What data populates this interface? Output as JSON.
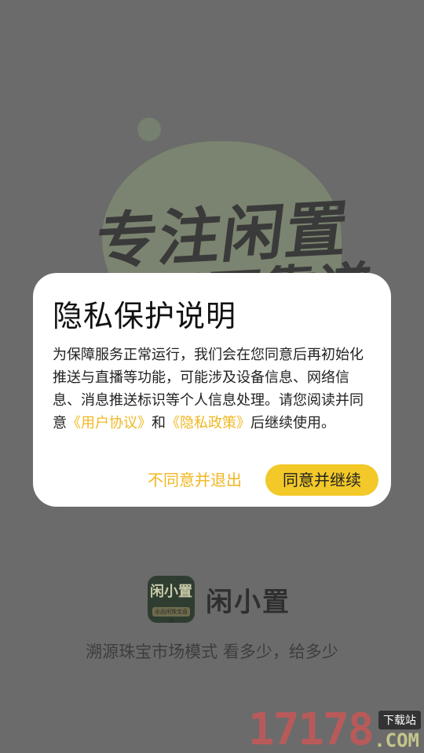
{
  "splash": {
    "slogan_line1": "专注闲置",
    "slogan_line2": "不只不靠谱",
    "brand_logo_text": "闲小置",
    "brand_logo_subtext": "全品闲珠宝直销",
    "brand_name": "闲小置",
    "brand_tagline": "溯源珠宝市场模式  看多少，给多少"
  },
  "watermark": {
    "number": "17178",
    "tag": "下载站",
    "domain": ".COM"
  },
  "dialog": {
    "title": "隐私保护说明",
    "body_prefix": "为保障服务正常运行，我们会在您同意后再初始化推送与直播等功能，可能涉及设备信息、网络信息、消息推送标识等个人信息处理。请您阅读并同意",
    "link_user_agreement": "《用户协议》",
    "body_and": "和",
    "link_privacy_policy": "《隐私政策》",
    "body_suffix": "后继续使用。",
    "disagree_label": "不同意并退出",
    "agree_label": "同意并继续"
  },
  "colors": {
    "accent": "#f2c928",
    "link": "#f0b720",
    "overlay": "#6b6b6b"
  }
}
